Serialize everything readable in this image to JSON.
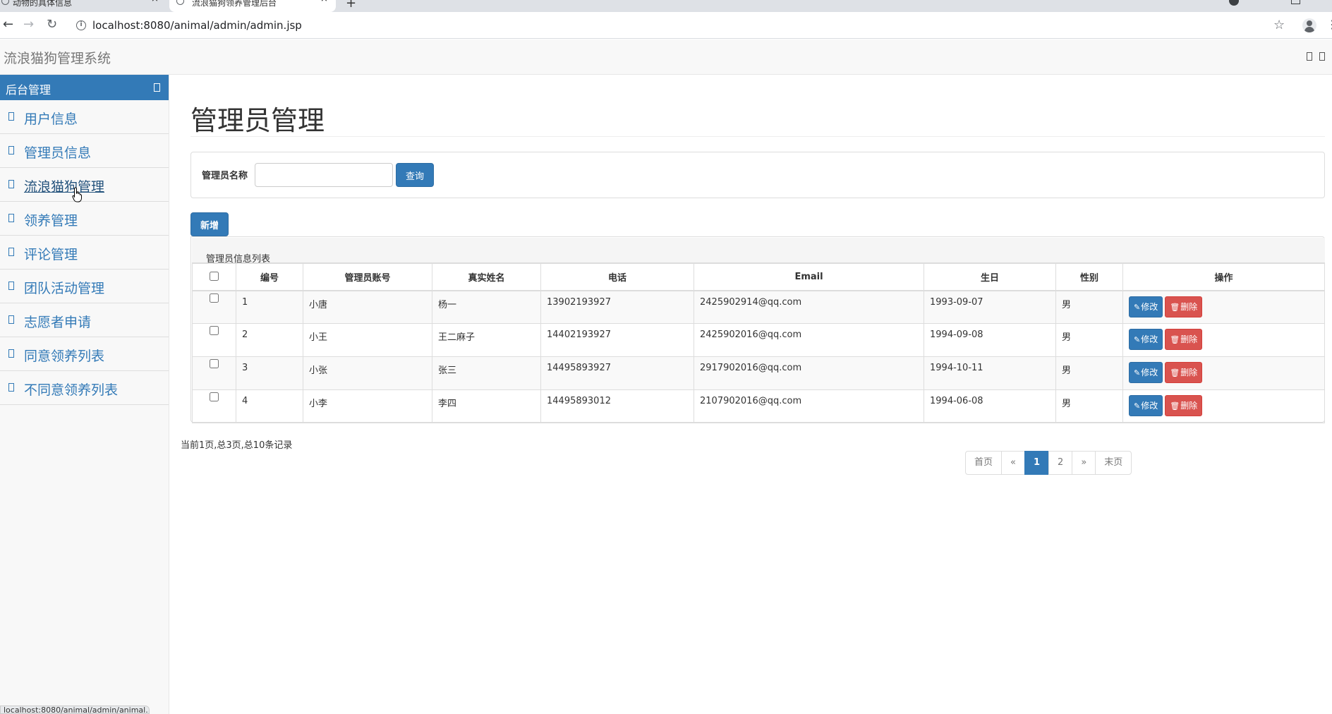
{
  "browser": {
    "tabs": [
      {
        "label": "动物的具体信息"
      },
      {
        "label": "流浪猫狗领养管理后台"
      }
    ],
    "url": "localhost:8080/animal/admin/admin.jsp",
    "status_url": "localhost:8080/animal/admin/animal..."
  },
  "header": {
    "brand": "流浪猫狗管理系统"
  },
  "sidebar": {
    "title": "后台管理",
    "items": [
      {
        "label": "用户信息"
      },
      {
        "label": "管理员信息"
      },
      {
        "label": "流浪猫狗管理"
      },
      {
        "label": "领养管理"
      },
      {
        "label": "评论管理"
      },
      {
        "label": "团队活动管理"
      },
      {
        "label": "志愿者申请"
      },
      {
        "label": "同意领养列表"
      },
      {
        "label": "不同意领养列表"
      }
    ]
  },
  "main": {
    "title": "管理员管理",
    "search": {
      "label": "管理员名称",
      "value": "",
      "placeholder": "",
      "button": "查询"
    },
    "add_button": "新增",
    "table": {
      "caption": "管理员信息列表",
      "headers": [
        "编号",
        "管理员账号",
        "真实姓名",
        "电话",
        "Email",
        "生日",
        "性别",
        "操作"
      ],
      "rows": [
        {
          "id": "1",
          "account": "小唐",
          "name": "杨一",
          "phone": "13902193927",
          "email": "2425902914@qq.com",
          "birthday": "1993-09-07",
          "gender": "男"
        },
        {
          "id": "2",
          "account": "小王",
          "name": "王二麻子",
          "phone": "14402193927",
          "email": "2425902016@qq.com",
          "birthday": "1994-09-08",
          "gender": "男"
        },
        {
          "id": "3",
          "account": "小张",
          "name": "张三",
          "phone": "14495893927",
          "email": "2917902016@qq.com",
          "birthday": "1994-10-11",
          "gender": "男"
        },
        {
          "id": "4",
          "account": "小李",
          "name": "李四",
          "phone": "14495893012",
          "email": "2107902016@qq.com",
          "birthday": "1994-06-08",
          "gender": "男"
        }
      ],
      "edit_label": "修改",
      "delete_label": "删除"
    },
    "page_info": "当前1页,总3页,总10条记录",
    "pagination": {
      "first": "首页",
      "prev": "«",
      "pages": [
        "1",
        "2"
      ],
      "next": "»",
      "last": "末页"
    }
  },
  "icons": {
    "sidebar_item": "file-icon",
    "edit": "pencil-icon",
    "delete": "trash-icon"
  },
  "colors": {
    "primary": "#337ab7",
    "danger": "#d9534f",
    "header_bg": "#f8f8f8"
  }
}
